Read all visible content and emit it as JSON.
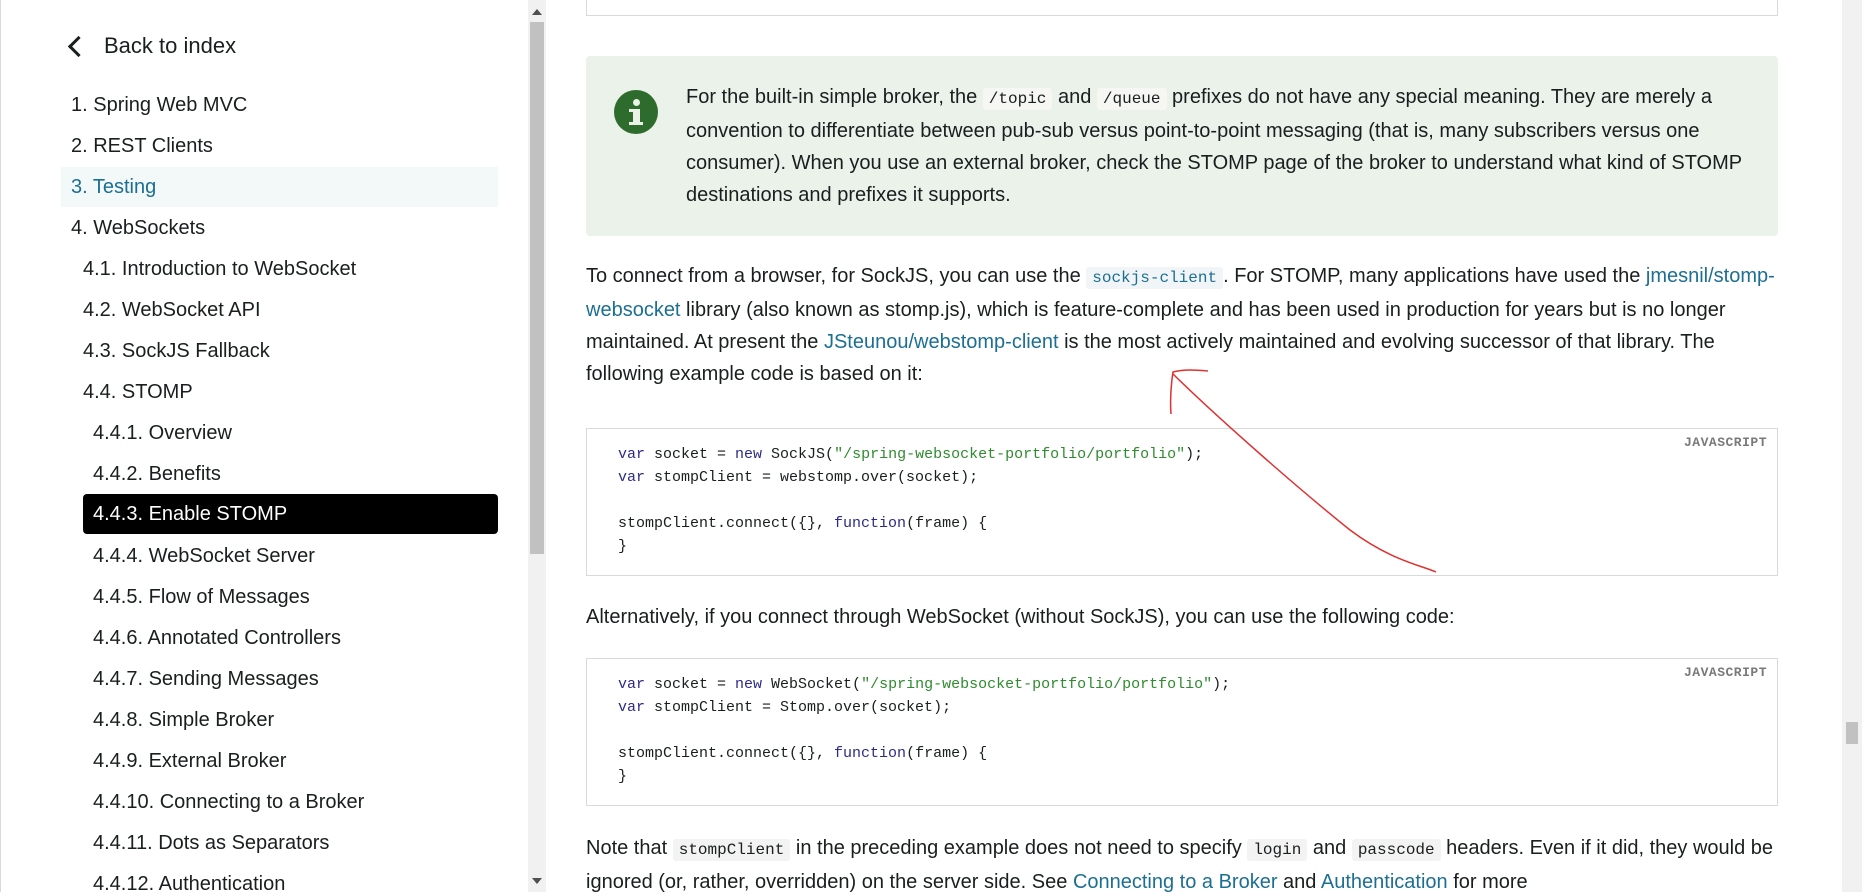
{
  "sidebar": {
    "back_label": "Back to index",
    "items": [
      {
        "label": "1. Spring Web MVC"
      },
      {
        "label": "2. REST Clients"
      },
      {
        "label": "3. Testing"
      },
      {
        "label": "4. WebSockets"
      },
      {
        "label": "4.1. Introduction to WebSocket"
      },
      {
        "label": "4.2. WebSocket API"
      },
      {
        "label": "4.3. SockJS Fallback"
      },
      {
        "label": "4.4. STOMP"
      },
      {
        "label": "4.4.1. Overview"
      },
      {
        "label": "4.4.2. Benefits"
      },
      {
        "label": "4.4.3. Enable STOMP"
      },
      {
        "label": "4.4.4. WebSocket Server"
      },
      {
        "label": "4.4.5. Flow of Messages"
      },
      {
        "label": "4.4.6. Annotated Controllers"
      },
      {
        "label": "4.4.7. Sending Messages"
      },
      {
        "label": "4.4.8. Simple Broker"
      },
      {
        "label": "4.4.9. External Broker"
      },
      {
        "label": "4.4.10. Connecting to a Broker"
      },
      {
        "label": "4.4.11. Dots as Separators"
      },
      {
        "label": "4.4.12. Authentication"
      }
    ]
  },
  "note": {
    "t1": "For the built-in simple broker, the ",
    "c1": "/topic",
    "t2": " and ",
    "c2": "/queue",
    "t3": " prefixes do not have any special meaning. They are merely a convention to differentiate between pub-sub versus point-to-point messaging (that is, many subscribers versus one consumer). When you use an external broker, check the STOMP page of the broker to understand what kind of STOMP destinations and prefixes it supports."
  },
  "para1": {
    "t1": "To connect from a browser, for SockJS, you can use the ",
    "c1": "sockjs-client",
    "t2": ". For STOMP, many applications have used the ",
    "link1": "jmesnil/stomp-websocket",
    "t3": " library (also known as stomp.js), which is feature-complete and has been used in production for years but is no longer maintained. At present the ",
    "link2": "JSteunou/webstomp-client",
    "t4": " is the most actively maintained and evolving successor of that library. The following example code is based on it:"
  },
  "code1": {
    "lang": "JAVASCRIPT",
    "l1_kw1": "var",
    "l1_a": " socket = ",
    "l1_kw2": "new",
    "l1_b": " SockJS(",
    "l1_str": "\"/spring-websocket-portfolio/portfolio\"",
    "l1_c": ");",
    "l2_kw": "var",
    "l2_a": " stompClient = webstomp.over(socket);",
    "l4_a": "stompClient.connect({}, ",
    "l4_kw": "function",
    "l4_b": "(frame) {",
    "l5": "}"
  },
  "para2": "Alternatively, if you connect through WebSocket (without SockJS), you can use the following code:",
  "code2": {
    "lang": "JAVASCRIPT",
    "l1_kw1": "var",
    "l1_a": " socket = ",
    "l1_kw2": "new",
    "l1_b": " WebSocket(",
    "l1_str": "\"/spring-websocket-portfolio/portfolio\"",
    "l1_c": ");",
    "l2_kw": "var",
    "l2_a": " stompClient = Stomp.over(socket);",
    "l4_a": "stompClient.connect({}, ",
    "l4_kw": "function",
    "l4_b": "(frame) {",
    "l5": "}"
  },
  "para3": {
    "t1": "Note that ",
    "c1": "stompClient",
    "t2": " in the preceding example does not need to specify ",
    "c2": "login",
    "t3": " and ",
    "c3": "passcode",
    "t4": " headers. Even if it did, they would be ignored (or, rather, overridden) on the server side. See ",
    "link1": "Connecting to a Broker",
    "t5": " and ",
    "link2": "Authentication",
    "t6": " for more"
  },
  "colors": {
    "link": "#1c6f93",
    "note_bg": "#ebf2ea",
    "note_icon": "#2e6c2e",
    "active_bg": "#000000",
    "annotation": "#e03030"
  }
}
